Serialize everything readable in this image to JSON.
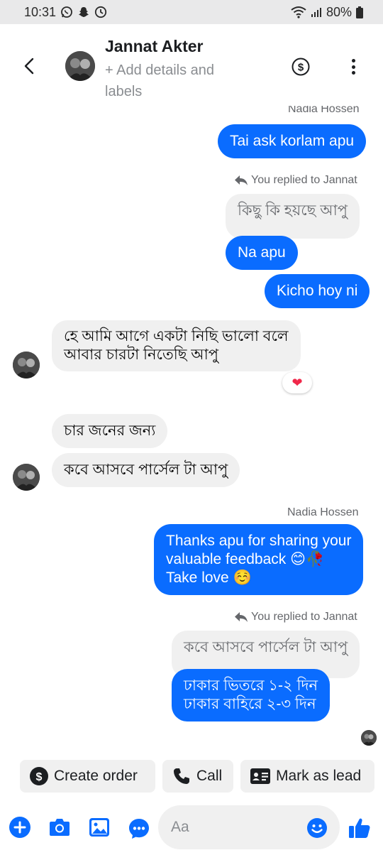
{
  "status_bar": {
    "time": "10:31",
    "battery": "80%"
  },
  "header": {
    "contact_name": "Jannat Akter",
    "subtitle": "+ Add details and labels"
  },
  "messages": {
    "top_label_partial": "Nadia Hossen",
    "m1": "Tai ask korlam apu",
    "reply1_label": "You replied to Jannat",
    "reply1_quote": "কিছু কি হয়ছে আপু",
    "m2": "Na apu",
    "m3": "Kicho hoy ni",
    "in1_line1": "হে আমি আগে একটা নিছি ভালো বলে",
    "in1_line2": "আবার চারটা নিতেছি আপু",
    "in1_reaction": "❤",
    "in2": "চার জনের জন্য",
    "in3": "কবে আসবে পার্সেল টা আপু",
    "sender2": "Nadia Hossen",
    "m4_line1": "Thanks apu for sharing your",
    "m4_line2": "valuable feedback 😊🥀",
    "m4_line3": "Take love ☺️",
    "reply2_label": "You replied to Jannat",
    "reply2_quote": "কবে আসবে পার্সেল টা আপু",
    "m5_line1": "ঢাকার ভিতরে ১-২ দিন",
    "m5_line2": "ঢাকার বাহিরে ২-৩ দিন"
  },
  "quick_actions": {
    "create_order": "Create order",
    "call": "Call",
    "mark_as_lead": "Mark as lead"
  },
  "composer": {
    "placeholder": "Aa"
  },
  "colors": {
    "accent": "#0a6cff",
    "incoming_bubble": "#f0f0f0"
  }
}
